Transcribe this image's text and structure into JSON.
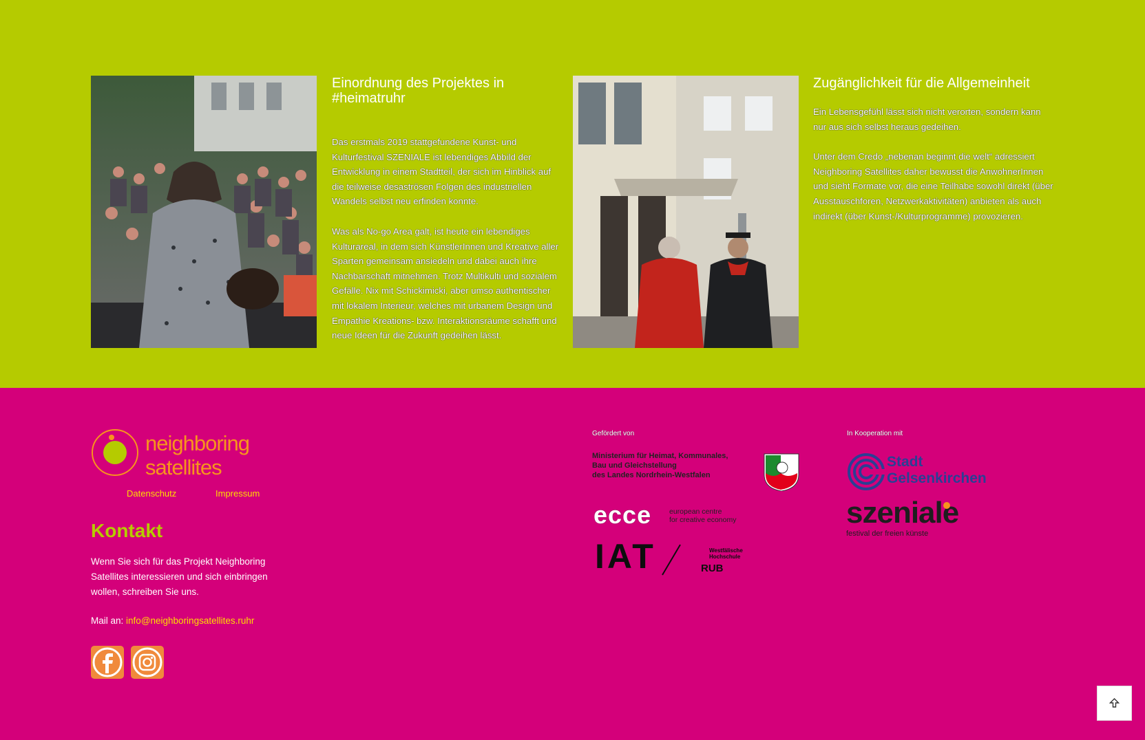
{
  "columns": [
    {
      "heading": "Einordnung des Projektes in #heimatruhr",
      "paragraphs": [
        "Das erstmals 2019 stattgefundene Kunst- und Kulturfestival SZENIALE ist lebendiges Abbild der Entwicklung in einem Stadtteil, der sich im Hinblick auf die teilweise desaströsen Folgen des industriellen Wandels selbst neu erfinden konnte.",
        "Was als No-go Area galt, ist heute ein lebendiges Kulturareal, in dem sich KünstlerInnen und Kreative aller Sparten gemeinsam ansiedeln und dabei auch ihre Nachbarschaft mitnehmen. Trotz Multikulti und sozialem Gefälle. Nix mit Schickimicki, aber umso authentischer mit lokalem Interieur, welches mit urbanem Design und Empathie Kreations- bzw. Interaktionsräume schafft und neue Ideen für die Zukunft gedeihen lässt."
      ]
    },
    {
      "heading": "Zugänglichkeit für die Allgemeinheit",
      "paragraphs": [
        "Ein Lebensgefühl lässt sich nicht verorten, sondern kann nur aus sich selbst heraus gedeihen.",
        "Unter dem Credo „nebenan beginnt die welt“ adressiert Neighboring Satellites daher bewusst die AnwohnerInnen und sieht Formate vor, die eine Teilhabe sowohl direkt (über Ausstauschforen, Netzwerkaktivitäten) anbieten als auch indirekt (über Kunst-/Kulturprogramme) provozieren."
      ]
    }
  ],
  "footer": {
    "logo": {
      "line1": "neighboring",
      "line2": "satellites"
    },
    "legal": {
      "datenschutz": "Datenschutz",
      "impressum": "Impressum"
    },
    "kontakt": {
      "heading": "Kontakt",
      "text": "Wenn Sie sich für das Projekt Neighboring Satellites interessieren und sich einbringen wollen, schreiben Sie uns.",
      "mail_label": "Mail an:",
      "email": "info@neighboringsatellites.ruhr"
    },
    "social": [
      {
        "icon": "facebook-icon"
      },
      {
        "icon": "instagram-icon"
      }
    ],
    "gefoerdert_label": "Gefördert von",
    "kooperation_label": "In Kooperation mit",
    "ministry": {
      "line1": "Ministerium für Heimat, Kommunales,",
      "line2": "Bau und Gleichstellung",
      "line3": "des Landes Nordrhein-Westfalen"
    },
    "ecce": {
      "name": "ecce",
      "line1": "european centre",
      "line2": "for creative economy"
    },
    "iat": {
      "name": "IAT",
      "whs_line1": "Westfälische",
      "whs_line2": "Hochschule",
      "rub": "RUB"
    },
    "gelsenkirchen": {
      "line1": "Stadt",
      "line2": "Gelsenkirchen"
    },
    "szeniale": {
      "name": "szeniale",
      "tagline": "festival der freien künste"
    }
  },
  "back_to_top_icon": "arrow-up-icon",
  "colors": {
    "green": "#b5cb00",
    "magenta": "#d4007a",
    "orange": "#f7941d",
    "yellow": "#ffdd00"
  }
}
